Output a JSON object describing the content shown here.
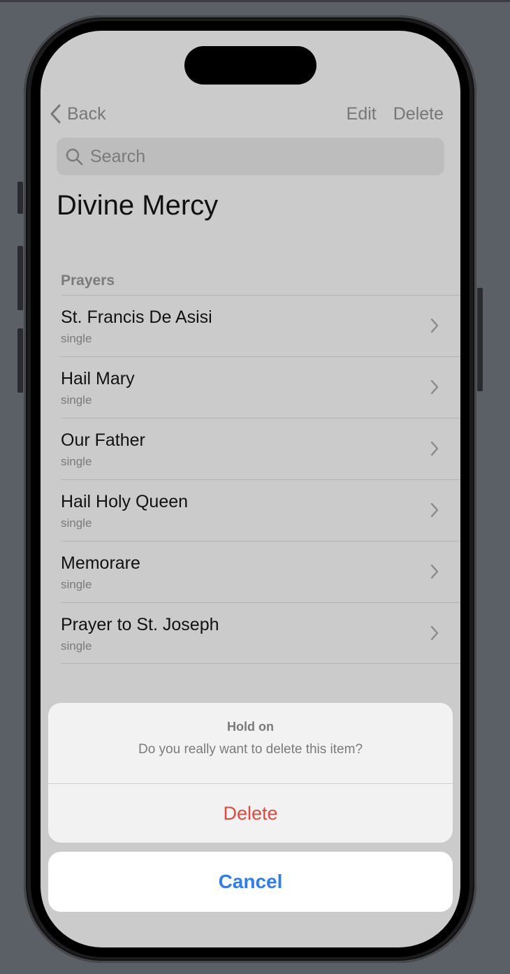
{
  "nav": {
    "back_label": "Back",
    "edit_label": "Edit",
    "delete_label": "Delete"
  },
  "search": {
    "placeholder": "Search"
  },
  "page": {
    "title": "Divine Mercy"
  },
  "section": {
    "header": "Prayers",
    "items": [
      {
        "title": "St. Francis De Asisi",
        "subtitle": "single"
      },
      {
        "title": "Hail Mary",
        "subtitle": "single"
      },
      {
        "title": "Our Father",
        "subtitle": "single"
      },
      {
        "title": "Hail Holy Queen",
        "subtitle": "single"
      },
      {
        "title": "Memorare",
        "subtitle": "single"
      },
      {
        "title": "Prayer to St. Joseph",
        "subtitle": "single"
      }
    ]
  },
  "action_sheet": {
    "title": "Hold on",
    "message": "Do you really want to delete this item?",
    "destructive_label": "Delete",
    "cancel_label": "Cancel"
  },
  "colors": {
    "destructive": "#e04a3c",
    "accent": "#2f7df2",
    "screen_bg": "#cbcbcb"
  },
  "icons": {
    "back": "chevron-left-icon",
    "search": "magnifier-icon",
    "row": "chevron-right-icon"
  }
}
